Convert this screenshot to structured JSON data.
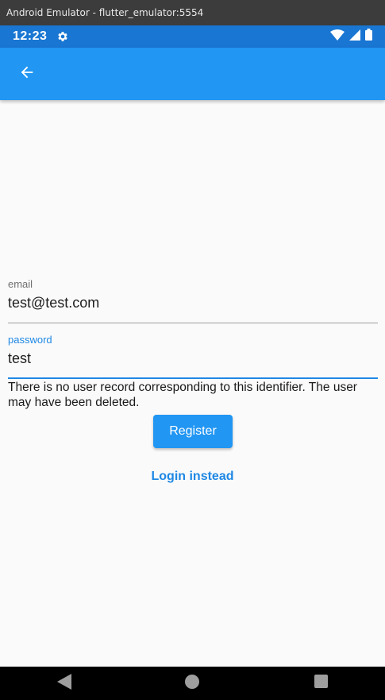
{
  "window": {
    "title": "Android Emulator - flutter_emulator:5554"
  },
  "status_bar": {
    "time": "12:23"
  },
  "form": {
    "email": {
      "label": "email",
      "value": "test@test.com"
    },
    "password": {
      "label": "password",
      "value": "test"
    },
    "error_message": "There is no user record corresponding to this identifier. The user may have been deleted.",
    "register_label": "Register",
    "login_instead_label": "Login instead"
  },
  "colors": {
    "accent": "#2196f3",
    "status_bar": "#1976d2",
    "focus": "#1e88e5"
  },
  "icons": {
    "status": [
      "settings-gear-icon",
      "wifi-icon",
      "cell-signal-icon",
      "battery-icon"
    ],
    "app_bar": [
      "back-arrow-icon"
    ],
    "nav": [
      "back-triangle-icon",
      "home-circle-icon",
      "recents-square-icon"
    ]
  }
}
